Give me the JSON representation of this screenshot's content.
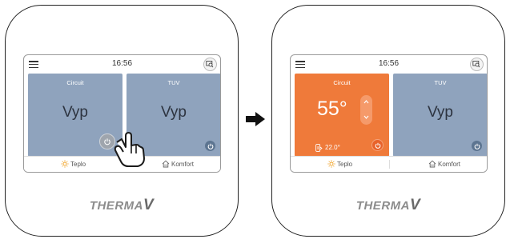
{
  "arrow": "right-arrow-icon",
  "devices": {
    "before": {
      "status_bar": {
        "time": "16:56",
        "menu_icon": "hamburger-menu-icon",
        "cast_icon": "cast-icon"
      },
      "tiles": [
        {
          "title": "Circuit",
          "status": "Vyp",
          "power_icon": "power-icon",
          "state": "off-pressed"
        },
        {
          "title": "TUV",
          "status": "Vyp",
          "power_icon": "power-icon",
          "state": "off"
        }
      ],
      "bottom_bar": {
        "mode_left": "Teplo",
        "mode_left_icon": "sun-icon",
        "mode_right": "Komfort",
        "mode_right_icon": "house-icon"
      },
      "logo": {
        "main": "THERMA",
        "suffix": "V"
      }
    },
    "after": {
      "status_bar": {
        "time": "16:56",
        "menu_icon": "hamburger-menu-icon",
        "cast_icon": "cast-icon"
      },
      "tiles": [
        {
          "title": "Circuit",
          "target_temp": "55°",
          "current_temp": "22.0°",
          "power_icon": "power-icon",
          "state": "on"
        },
        {
          "title": "TUV",
          "status": "Vyp",
          "power_icon": "power-icon",
          "state": "off"
        }
      ],
      "bottom_bar": {
        "mode_left": "Teplo",
        "mode_left_icon": "sun-icon",
        "mode_right": "Komfort",
        "mode_right_icon": "house-icon"
      },
      "logo": {
        "main": "THERMA",
        "suffix": "V"
      }
    }
  },
  "colors": {
    "tile_off": "#8fa3bd",
    "tile_on": "#ef7a3a",
    "power_off": "#5d7591",
    "power_on": "#e8622a"
  }
}
